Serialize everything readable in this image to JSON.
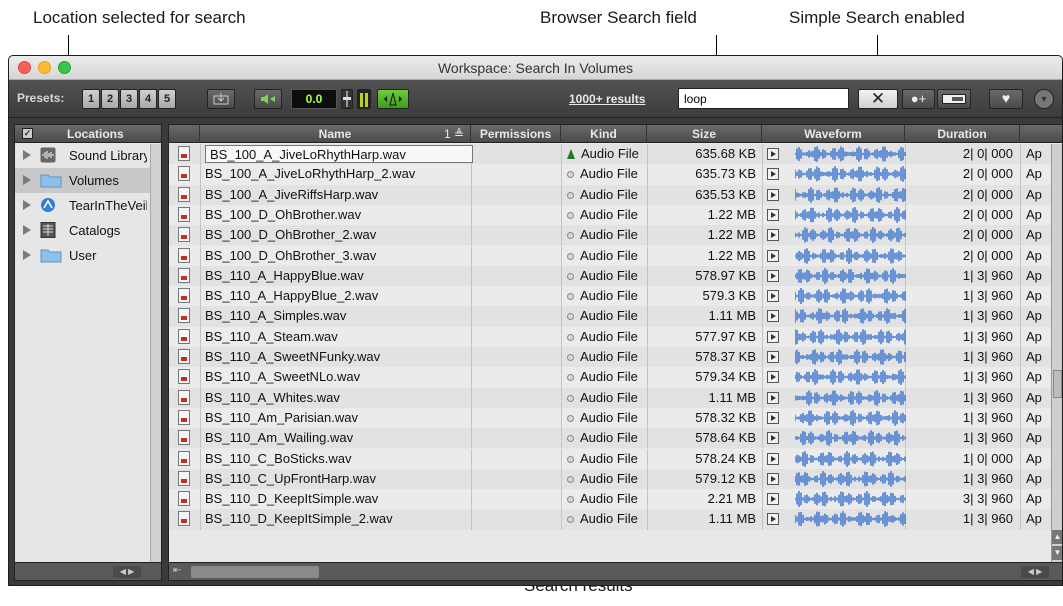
{
  "callouts": {
    "location": "Location selected for search",
    "browser_search": "Browser Search field",
    "simple_search": "Simple Search enabled",
    "search_results": "Search results"
  },
  "window": {
    "title": "Workspace: Search In Volumes"
  },
  "toolbar": {
    "presets_label": "Presets:",
    "presets": [
      "1",
      "2",
      "3",
      "4",
      "5"
    ],
    "volume_value": "0.0",
    "results_label": "1000+ results",
    "search_value": "loop"
  },
  "colors": {
    "waveform": "#4a7fd0",
    "selection_green": "#1f7a22",
    "volume_text": "#a8ff4a"
  },
  "sidebar": {
    "header": "Locations",
    "items": [
      {
        "label": "Sound Library",
        "icon": "sound-library-icon"
      },
      {
        "label": "Volumes",
        "icon": "folder-icon"
      },
      {
        "label": "TearInTheVeil",
        "icon": "workspace-icon"
      },
      {
        "label": "Catalogs",
        "icon": "catalog-icon"
      },
      {
        "label": "User",
        "icon": "folder-icon"
      }
    ]
  },
  "table": {
    "columns": {
      "name": "Name",
      "sort": "1 ≜",
      "permissions": "Permissions",
      "kind": "Kind",
      "size": "Size",
      "waveform": "Waveform",
      "duration": "Duration"
    },
    "rows": [
      {
        "name": "BS_100_A_JiveLoRhythHarp.wav",
        "kind": "Audio File",
        "size": "635.68 KB",
        "duration": "2| 0| 000",
        "extra": "Ap"
      },
      {
        "name": "BS_100_A_JiveLoRhythHarp_2.wav",
        "kind": "Audio File",
        "size": "635.73 KB",
        "duration": "2| 0| 000",
        "extra": "Ap"
      },
      {
        "name": "BS_100_A_JiveRiffsHarp.wav",
        "kind": "Audio File",
        "size": "635.53 KB",
        "duration": "2| 0| 000",
        "extra": "Ap"
      },
      {
        "name": "BS_100_D_OhBrother.wav",
        "kind": "Audio File",
        "size": "1.22 MB",
        "duration": "2| 0| 000",
        "extra": "Ap"
      },
      {
        "name": "BS_100_D_OhBrother_2.wav",
        "kind": "Audio File",
        "size": "1.22 MB",
        "duration": "2| 0| 000",
        "extra": "Ap"
      },
      {
        "name": "BS_100_D_OhBrother_3.wav",
        "kind": "Audio File",
        "size": "1.22 MB",
        "duration": "2| 0| 000",
        "extra": "Ap"
      },
      {
        "name": "BS_110_A_HappyBlue.wav",
        "kind": "Audio File",
        "size": "578.97 KB",
        "duration": "1| 3| 960",
        "extra": "Ap"
      },
      {
        "name": "BS_110_A_HappyBlue_2.wav",
        "kind": "Audio File",
        "size": "579.3 KB",
        "duration": "1| 3| 960",
        "extra": "Ap"
      },
      {
        "name": "BS_110_A_Simples.wav",
        "kind": "Audio File",
        "size": "1.11 MB",
        "duration": "1| 3| 960",
        "extra": "Ap"
      },
      {
        "name": "BS_110_A_Steam.wav",
        "kind": "Audio File",
        "size": "577.97 KB",
        "duration": "1| 3| 960",
        "extra": "Ap"
      },
      {
        "name": "BS_110_A_SweetNFunky.wav",
        "kind": "Audio File",
        "size": "578.37 KB",
        "duration": "1| 3| 960",
        "extra": "Ap"
      },
      {
        "name": "BS_110_A_SweetNLo.wav",
        "kind": "Audio File",
        "size": "579.34 KB",
        "duration": "1| 3| 960",
        "extra": "Ap"
      },
      {
        "name": "BS_110_A_Whites.wav",
        "kind": "Audio File",
        "size": "1.11 MB",
        "duration": "1| 3| 960",
        "extra": "Ap"
      },
      {
        "name": "BS_110_Am_Parisian.wav",
        "kind": "Audio File",
        "size": "578.32 KB",
        "duration": "1| 3| 960",
        "extra": "Ap"
      },
      {
        "name": "BS_110_Am_Wailing.wav",
        "kind": "Audio File",
        "size": "578.64 KB",
        "duration": "1| 3| 960",
        "extra": "Ap"
      },
      {
        "name": "BS_110_C_BoSticks.wav",
        "kind": "Audio File",
        "size": "578.24 KB",
        "duration": "1| 0| 000",
        "extra": "Ap"
      },
      {
        "name": "BS_110_C_UpFrontHarp.wav",
        "kind": "Audio File",
        "size": "579.12 KB",
        "duration": "1| 3| 960",
        "extra": "Ap"
      },
      {
        "name": "BS_110_D_KeepItSimple.wav",
        "kind": "Audio File",
        "size": "2.21 MB",
        "duration": "3| 3| 960",
        "extra": "Ap"
      },
      {
        "name": "BS_110_D_KeepItSimple_2.wav",
        "kind": "Audio File",
        "size": "1.11 MB",
        "duration": "1| 3| 960",
        "extra": "Ap"
      }
    ]
  }
}
